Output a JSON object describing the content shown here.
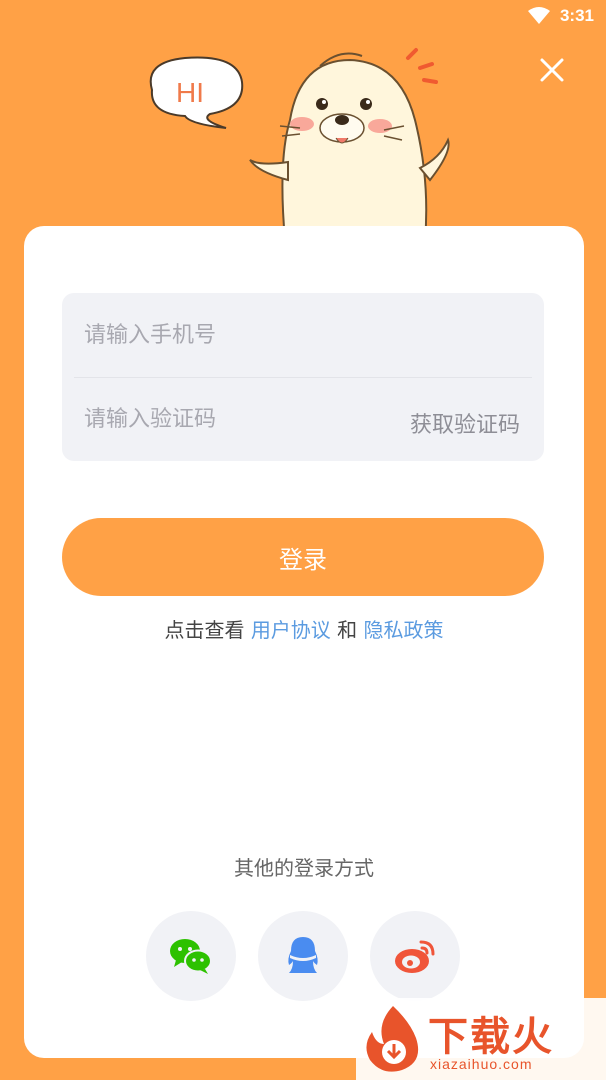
{
  "status_bar": {
    "time": "3:31"
  },
  "mascot": {
    "speech": "HI"
  },
  "login_form": {
    "phone_placeholder": "请输入手机号",
    "code_placeholder": "请输入验证码",
    "get_code_label": "获取验证码",
    "login_label": "登录"
  },
  "agreement": {
    "prefix": "点击查看 ",
    "user_agreement": "用户协议",
    "conjunction": " 和 ",
    "privacy_policy": "隐私政策"
  },
  "other_login": {
    "title": "其他的登录方式",
    "methods": [
      {
        "icon": "wechat-icon",
        "color": "#2DC100"
      },
      {
        "icon": "qq-icon",
        "color": "#4A8CF0"
      },
      {
        "icon": "weibo-icon",
        "color": "#F0553A"
      }
    ]
  },
  "watermark": {
    "title": "下载火",
    "url": "xiazaihuo.com"
  },
  "colors": {
    "accent": "#FFA146",
    "link": "#5B9BE0",
    "input_bg": "#F1F2F6"
  }
}
